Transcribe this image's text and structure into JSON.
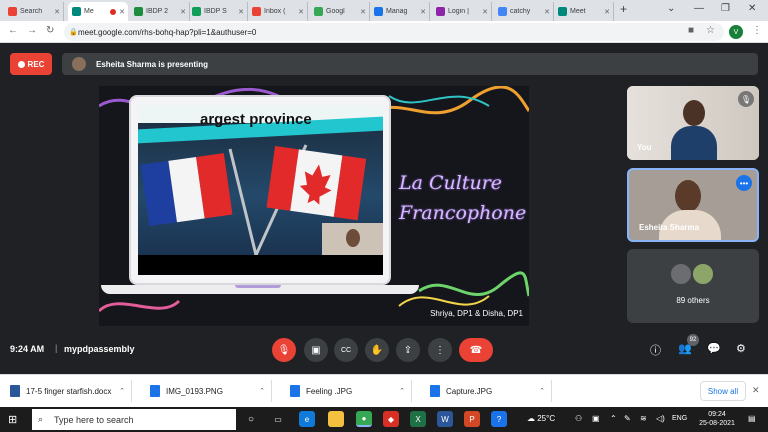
{
  "browser": {
    "tabs": [
      {
        "label": "Search",
        "favicon_color": "#ea4335",
        "active": false
      },
      {
        "label": "Me",
        "favicon_color": "#00897b",
        "active": true,
        "recording": true
      },
      {
        "label": "IBDP 2",
        "favicon_color": "#1e8e3e",
        "active": false
      },
      {
        "label": "IBDP S",
        "favicon_color": "#0f9d58",
        "active": false
      },
      {
        "label": "Inbox (",
        "favicon_color": "#ea4335",
        "active": false
      },
      {
        "label": "Googl",
        "favicon_color": "#34a853",
        "active": false
      },
      {
        "label": "Manag",
        "favicon_color": "#1a73e8",
        "active": false
      },
      {
        "label": "Login |",
        "favicon_color": "#8e24aa",
        "active": false
      },
      {
        "label": "catchy",
        "favicon_color": "#4285f4",
        "active": false
      },
      {
        "label": "Meet",
        "favicon_color": "#00897b",
        "active": false
      }
    ],
    "new_tab": "+",
    "url": "meet.google.com/rhs-bohq-hap?pli=1&authuser=0",
    "profile_initial": "V"
  },
  "meet": {
    "rec_label": "REC",
    "presenting_text": "Esheita Sharma is presenting",
    "slide": {
      "video_caption": "argest province",
      "title": "La Culture Francophone",
      "credit": "Shriya, DP1 & Disha, DP1"
    },
    "tiles": {
      "you_label": "You",
      "presenter_label": "Esheita Sharma",
      "others_label": "89 others"
    },
    "time": "9:24 AM",
    "meeting_name": "mypdpassembly",
    "people_count": "92"
  },
  "downloads": {
    "items": [
      {
        "label": "17-5 finger starfish.docx",
        "color": "#2b579a"
      },
      {
        "label": "IMG_0193.PNG",
        "color": "#1a73e8"
      },
      {
        "label": "Feeling .JPG",
        "color": "#1a73e8"
      },
      {
        "label": "Capture.JPG",
        "color": "#1a73e8"
      }
    ],
    "show_all": "Show all"
  },
  "taskbar": {
    "search_placeholder": "Type here to search",
    "weather": "25°C",
    "language": "ENG",
    "clock_time": "09:24",
    "clock_date": "25-08-2021"
  }
}
